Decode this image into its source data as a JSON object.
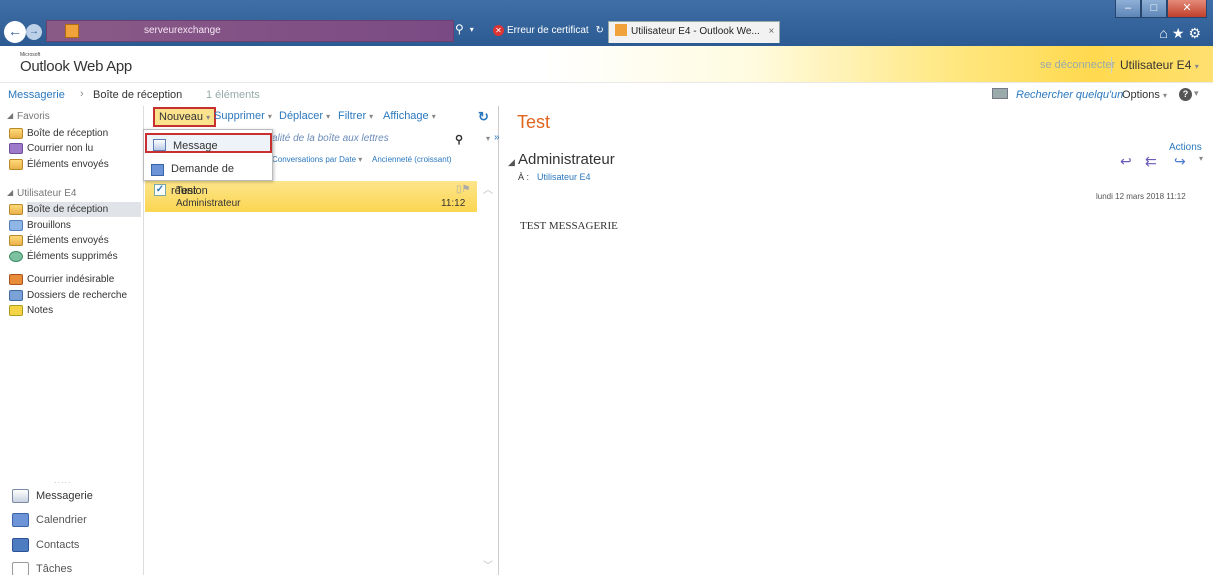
{
  "browser": {
    "address": "serveurexchange",
    "cert_tab": "Erreur de certificat",
    "active_tab": "Utilisateur E4 - Outlook We...",
    "active_tab_close": "×"
  },
  "header": {
    "brand_small": "Microsoft",
    "brand": "Outlook Web App",
    "logout": "se déconnecter",
    "user": "Utilisateur E4"
  },
  "breadcrumb": {
    "mail": "Messagerie",
    "separator": "›",
    "folder": "Boîte de réception",
    "count": "1 éléments",
    "search_person": "Rechercher quelqu'un",
    "options": "Options"
  },
  "nav": {
    "favorites_header": "Favoris",
    "favorites": [
      "Boîte de réception",
      "Courrier non lu",
      "Éléments envoyés"
    ],
    "mailbox_header": "Utilisateur E4",
    "mailbox": [
      "Boîte de réception",
      "Brouillons",
      "Éléments envoyés",
      "Éléments supprimés",
      "Courrier indésirable",
      "Dossiers de recherche",
      "Notes"
    ],
    "dots": ".....",
    "modules": [
      "Messagerie",
      "Calendrier",
      "Contacts",
      "Tâches"
    ]
  },
  "toolbar": {
    "new": "Nouveau",
    "delete": "Supprimer",
    "move": "Déplacer",
    "filter": "Filtrer",
    "view": "Affichage"
  },
  "new_menu": {
    "message": "Message",
    "meeting": "Demande de réunion"
  },
  "list": {
    "search_placeholder": "alité de la boîte aux lettres",
    "sort_conversations": "Conversations par Date",
    "sort_order": "Ancienneté (croissant)",
    "message": {
      "subject": "Test",
      "sender": "Administrateur",
      "time": "11:12"
    }
  },
  "reading": {
    "subject": "Test",
    "actions": "Actions",
    "from": "Administrateur",
    "to_label": "À :",
    "to": "Utilisateur E4",
    "date": "lundi 12 mars 2018 11:12",
    "body": "TEST MESSAGERIE"
  },
  "colors": {
    "accent_blue": "#2b78be",
    "subject_orange": "#e0641e",
    "selection_yellow": "#fbd652",
    "highlight_red": "#c8302f"
  }
}
